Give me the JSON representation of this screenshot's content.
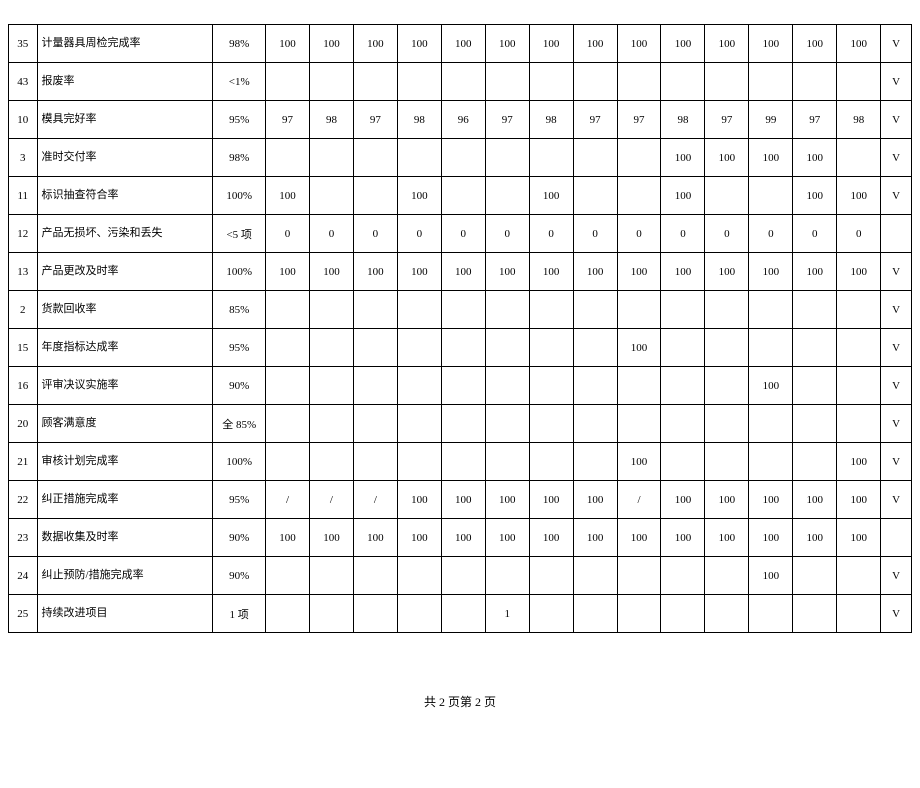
{
  "footer": "共 2 页第 2 页",
  "rows": [
    {
      "idx": "35",
      "name": "计量器具周检完成率",
      "target": "98%",
      "vals": [
        "100",
        "100",
        "100",
        "100",
        "100",
        "100",
        "100",
        "100",
        "100",
        "100",
        "100",
        "100",
        "100",
        "100"
      ],
      "flag": "V"
    },
    {
      "idx": "43",
      "name": "报废率",
      "target": "<1%",
      "vals": [
        "",
        "",
        "",
        "",
        "",
        "",
        "",
        "",
        "",
        "",
        "",
        "",
        "",
        ""
      ],
      "flag": "V"
    },
    {
      "idx": "10",
      "name": "模具完好率",
      "target": "95%",
      "vals": [
        "97",
        "98",
        "97",
        "98",
        "96",
        "97",
        "98",
        "97",
        "97",
        "98",
        "97",
        "99",
        "97",
        "98"
      ],
      "flag": "V"
    },
    {
      "idx": "3",
      "name": "准时交付率",
      "target": "98%",
      "vals": [
        "",
        "",
        "",
        "",
        "",
        "",
        "",
        "",
        "",
        "100",
        "100",
        "100",
        "100",
        ""
      ],
      "flag": "V"
    },
    {
      "idx": "11",
      "name": "标识抽查符合率",
      "target": "100%",
      "vals": [
        "100",
        "",
        "",
        "100",
        "",
        "",
        "100",
        "",
        "",
        "100",
        "",
        "",
        "100",
        "100"
      ],
      "flag": "V"
    },
    {
      "idx": "12",
      "name": "产品无损坏、污染和丢失",
      "target": "<5 项",
      "vals": [
        "0",
        "0",
        "0",
        "0",
        "0",
        "0",
        "0",
        "0",
        "0",
        "0",
        "0",
        "0",
        "0",
        "0"
      ],
      "flag": ""
    },
    {
      "idx": "13",
      "name": "产品更改及时率",
      "target": "100%",
      "vals": [
        "100",
        "100",
        "100",
        "100",
        "100",
        "100",
        "100",
        "100",
        "100",
        "100",
        "100",
        "100",
        "100",
        "100"
      ],
      "flag": "V"
    },
    {
      "idx": "2",
      "name": "货款回收率",
      "target": "85%",
      "vals": [
        "",
        "",
        "",
        "",
        "",
        "",
        "",
        "",
        "",
        "",
        "",
        "",
        "",
        ""
      ],
      "flag": "V"
    },
    {
      "idx": "15",
      "name": "年度指标达成率",
      "target": "95%",
      "vals": [
        "",
        "",
        "",
        "",
        "",
        "",
        "",
        "",
        "100",
        "",
        "",
        "",
        "",
        ""
      ],
      "flag": "V"
    },
    {
      "idx": "16",
      "name": "评审决议实施率",
      "target": "90%",
      "vals": [
        "",
        "",
        "",
        "",
        "",
        "",
        "",
        "",
        "",
        "",
        "",
        "100",
        "",
        ""
      ],
      "flag": "V"
    },
    {
      "idx": "20",
      "name": "顾客满意度",
      "target": "全 85%",
      "vals": [
        "",
        "",
        "",
        "",
        "",
        "",
        "",
        "",
        "",
        "",
        "",
        "",
        "",
        ""
      ],
      "flag": "V"
    },
    {
      "idx": "21",
      "name": "审核计划完成率",
      "target": "100%",
      "vals": [
        "",
        "",
        "",
        "",
        "",
        "",
        "",
        "",
        "100",
        "",
        "",
        "",
        "",
        "100"
      ],
      "flag": "V"
    },
    {
      "idx": "22",
      "name": "纠正措施完成率",
      "target": "95%",
      "vals": [
        "/",
        "/",
        "/",
        "100",
        "100",
        "100",
        "100",
        "100",
        "/",
        "100",
        "100",
        "100",
        "100",
        "100"
      ],
      "flag": "V"
    },
    {
      "idx": "23",
      "name": "数据收集及时率",
      "target": "90%",
      "vals": [
        "100",
        "100",
        "100",
        "100",
        "100",
        "100",
        "100",
        "100",
        "100",
        "100",
        "100",
        "100",
        "100",
        "100"
      ],
      "flag": ""
    },
    {
      "idx": "24",
      "name": "纠止预防/措施完成率",
      "target": "90%",
      "vals": [
        "",
        "",
        "",
        "",
        "",
        "",
        "",
        "",
        "",
        "",
        "",
        "100",
        "",
        ""
      ],
      "flag": "V"
    },
    {
      "idx": "25",
      "name": "持续改进项目",
      "target": "1 项",
      "vals": [
        "",
        "",
        "",
        "",
        "",
        "1",
        "",
        "",
        "",
        "",
        "",
        "",
        "",
        ""
      ],
      "flag": "V"
    }
  ]
}
